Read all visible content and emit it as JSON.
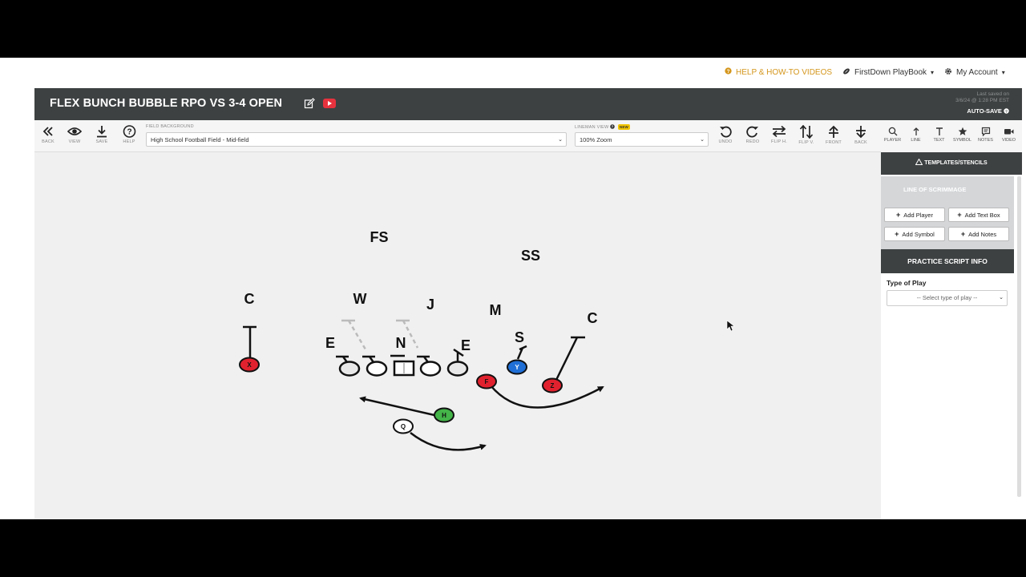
{
  "topnav": {
    "help_label": "HELP & HOW-TO VIDEOS",
    "playbook_label": "FirstDown PlayBook",
    "account_label": "My Account"
  },
  "header": {
    "play_title": "FLEX BUNCH BUBBLE RPO VS 3-4 OPEN",
    "last_saved_line1": "Last saved on",
    "last_saved_line2": "3/6/24 @ 1:28 PM EST",
    "autosave_label": "AUTO-SAVE"
  },
  "toolbar": {
    "back_label": "BACK",
    "view_label": "VIEW",
    "save_label": "SAVE",
    "help_label": "HELP",
    "field_background_label": "FIELD BACKGROUND",
    "field_background_value": "High School Football Field - Mid-field",
    "lineman_view_label": "LINEMAN VIEW",
    "new_badge": "NEW",
    "lineman_view_value": "100% Zoom",
    "undo_label": "UNDO",
    "redo_label": "REDO",
    "flip_h_label": "FLIP H.",
    "flip_v_label": "FLIP V.",
    "front_label": "FRONT",
    "back2_label": "BACK"
  },
  "sidebar": {
    "tabs": [
      "PLAYER",
      "LINE",
      "TEXT",
      "SYMBOL",
      "NOTES",
      "VIDEO"
    ],
    "templates_label": "TEMPLATES/STENCILS",
    "los_label": "LINE OF SCRIMMAGE",
    "add_player": "Add Player",
    "add_text_box": "Add Text Box",
    "add_symbol": "Add Symbol",
    "add_notes": "Add Notes",
    "practice_script_label": "PRACTICE SCRIPT INFO",
    "type_of_play_label": "Type of Play",
    "type_of_play_value": "-- Select type of play --"
  },
  "play": {
    "defenders": {
      "fs": "FS",
      "ss": "SS",
      "c_left": "C",
      "w": "W",
      "j": "J",
      "m": "M",
      "c_right": "C",
      "e_left": "E",
      "n": "N",
      "e_right": "E",
      "s": "S"
    },
    "offense": {
      "x": "X",
      "f": "F",
      "y": "Y",
      "z": "Z",
      "h": "H",
      "q": "Q"
    },
    "colors": {
      "red": "#e1222e",
      "blue": "#1f6fd6",
      "green": "#44b549",
      "accent_orange": "#d4961c",
      "header_dark": "#3e4142"
    }
  }
}
